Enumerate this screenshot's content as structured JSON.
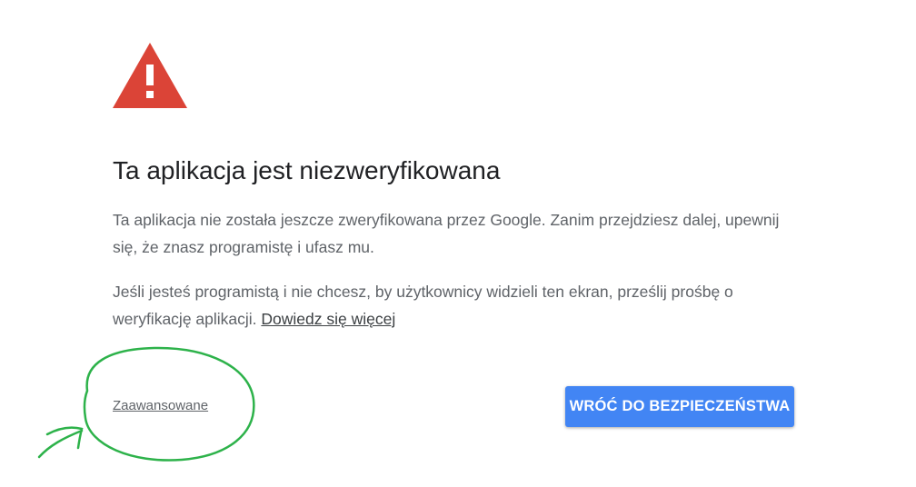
{
  "colors": {
    "warning_red": "#db4437",
    "button_blue": "#4285f4",
    "annotation_green": "#2db24a"
  },
  "icon": "warning-triangle-icon",
  "title": "Ta aplikacja jest niezweryfikowana",
  "paragraph1": "Ta aplikacja nie została jeszcze zweryfikowana przez Google. Zanim przejdziesz dalej, upewnij się, że znasz programistę i ufasz mu.",
  "paragraph2": {
    "text": "Jeśli jesteś programistą i nie chcesz, by użytkownicy widzieli ten ekran, prześlij prośbę o weryfikację aplikacji. ",
    "link_label": "Dowiedz się więcej"
  },
  "advanced_label": "Zaawansowane",
  "back_button_label": "WRÓĆ DO BEZPIECZEŃSTWA"
}
